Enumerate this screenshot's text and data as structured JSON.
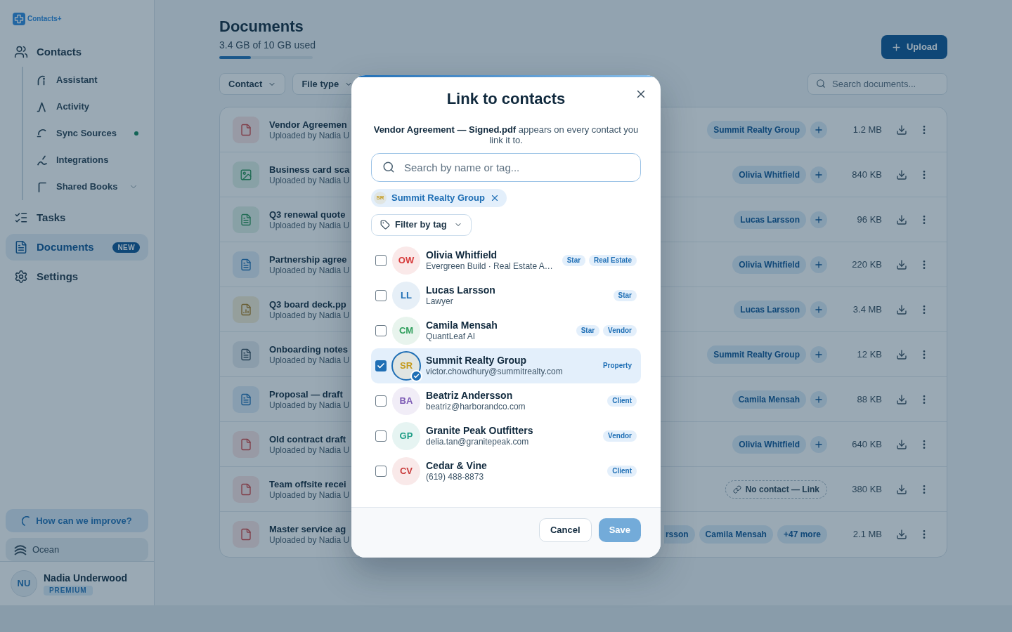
{
  "sidebar": {
    "logo": "Contacts+",
    "nav": [
      {
        "label": "Contacts",
        "selected": false,
        "children": [
          {
            "label": "Assistant",
            "selected": false,
            "status_dot": false
          },
          {
            "label": "Activity",
            "selected": false,
            "status_dot": false
          },
          {
            "label": "Sync Sources",
            "selected": false,
            "status_dot": true
          },
          {
            "label": "Integrations",
            "selected": false,
            "status_dot": false
          },
          {
            "label": "Shared Books",
            "selected": false,
            "status_dot": false,
            "expanded": false
          }
        ]
      },
      {
        "label": "Tasks",
        "selected": false
      },
      {
        "label": "Documents",
        "selected": true,
        "badge": "NEW"
      },
      {
        "label": "Settings",
        "selected": false
      }
    ],
    "feedback_button": "How can we improve?",
    "theme_button": "Ocean",
    "user": {
      "initials": "NU",
      "name": "Nadia Underwood",
      "plan": "PREMIUM"
    }
  },
  "main": {
    "title": "Documents",
    "usage": "3.4 GB of 10 GB used",
    "storage": {
      "level": 0.34
    },
    "upload_button": "Upload",
    "filters": [
      "Contact",
      "File type"
    ],
    "search": {
      "placeholder": "Search documents..."
    },
    "documents": [
      {
        "kind": "pdf",
        "title": "Vendor Agreemen",
        "uploader": "Uploaded by Nadia U",
        "contacts": [
          {
            "kind": "contact",
            "label": "Summit Realty Group"
          }
        ],
        "add_button": true,
        "size": "1.2 MB"
      },
      {
        "kind": "image",
        "title": "Business card sca",
        "uploader": "Uploaded by Nadia U",
        "contacts": [
          {
            "kind": "contact",
            "label": "Olivia Whitfield"
          }
        ],
        "add_button": true,
        "size": "840 KB"
      },
      {
        "kind": "sheet",
        "title": "Q3 renewal quote",
        "uploader": "Uploaded by Nadia U",
        "contacts": [
          {
            "kind": "contact",
            "label": "Lucas Larsson"
          }
        ],
        "add_button": true,
        "size": "96 KB"
      },
      {
        "kind": "doc",
        "title": "Partnership agree",
        "uploader": "Uploaded by Nadia U",
        "contacts": [
          {
            "kind": "contact",
            "label": "Olivia Whitfield"
          }
        ],
        "add_button": true,
        "size": "220 KB"
      },
      {
        "kind": "slides",
        "title": "Q3 board deck.pp",
        "uploader": "Uploaded by Nadia U",
        "contacts": [
          {
            "kind": "contact",
            "label": "Lucas Larsson"
          }
        ],
        "add_button": true,
        "size": "3.4 MB"
      },
      {
        "kind": "note",
        "title": "Onboarding notes",
        "uploader": "Uploaded by Nadia U",
        "contacts": [
          {
            "kind": "contact",
            "label": "Summit Realty Group"
          }
        ],
        "add_button": true,
        "size": "12 KB"
      },
      {
        "kind": "doc",
        "title": "Proposal — draft",
        "uploader": "Uploaded by Nadia U",
        "contacts": [
          {
            "kind": "contact",
            "label": "Camila Mensah"
          }
        ],
        "add_button": true,
        "size": "88 KB"
      },
      {
        "kind": "pdf",
        "title": "Old contract draft",
        "uploader": "Uploaded by Nadia U",
        "contacts": [
          {
            "kind": "contact",
            "label": "Olivia Whitfield"
          }
        ],
        "add_button": true,
        "size": "640 KB"
      },
      {
        "kind": "pdf",
        "title": "Team offsite recei",
        "uploader": "Uploaded by Nadia U",
        "contacts": [
          {
            "kind": "none",
            "label": "No contact — Link"
          }
        ],
        "add_button": false,
        "size": "380 KB"
      },
      {
        "kind": "pdf",
        "title": "Master service ag",
        "uploader": "Uploaded by Nadia U",
        "contacts": [
          {
            "kind": "partial",
            "label": "rsson"
          },
          {
            "kind": "contact",
            "label": "Camila Mensah"
          },
          {
            "kind": "more",
            "label": "+47 more"
          }
        ],
        "add_button": false,
        "size": "2.1 MB"
      }
    ]
  },
  "modal": {
    "title": "Link to contacts",
    "description": "**Vendor Agreement — Signed.pdf** appears on every contact you link it to.",
    "search": {
      "placeholder": "Search by name or tag..."
    },
    "chips": [
      {
        "initials": "SR",
        "label": "Summit Realty Group",
        "color": "#c49a1c"
      }
    ],
    "filter_button": "Filter by tag",
    "contacts": [
      {
        "initials": "OW",
        "color": "#d63b3b",
        "name": "Olivia Whitfield",
        "detail": "Evergreen Build · Real Estate A…",
        "tags": [
          "Star",
          "Real Estate"
        ],
        "checked": false
      },
      {
        "initials": "LL",
        "color": "#1f6fb5",
        "name": "Lucas Larsson",
        "detail": "Lawyer",
        "tags": [
          "Star"
        ],
        "checked": false
      },
      {
        "initials": "CM",
        "color": "#2e9e5b",
        "name": "Camila Mensah",
        "detail": "QuantLeaf AI",
        "tags": [
          "Star",
          "Vendor"
        ],
        "checked": false
      },
      {
        "initials": "SR",
        "color": "#c49a1c",
        "name": "Summit Realty Group",
        "detail": "victor.chowdhury@summitrealty.com",
        "tags": [
          "Property"
        ],
        "checked": true
      },
      {
        "initials": "BA",
        "color": "#7d5bb5",
        "name": "Beatriz Andersson",
        "detail": "beatriz@harborandco.com",
        "tags": [
          "Client"
        ],
        "checked": false
      },
      {
        "initials": "GP",
        "color": "#1f9e86",
        "name": "Granite Peak Outfitters",
        "detail": "delia.tan@granitepeak.com",
        "tags": [
          "Vendor"
        ],
        "checked": false
      },
      {
        "initials": "CV",
        "color": "#c83a3a",
        "name": "Cedar & Vine",
        "detail": "(619) 488-8873",
        "tags": [
          "Client"
        ],
        "checked": false
      }
    ],
    "buttons": [
      {
        "kind": "secondary",
        "label": "Cancel",
        "disabled": false
      },
      {
        "kind": "primary",
        "label": "Save",
        "disabled": true
      }
    ]
  }
}
